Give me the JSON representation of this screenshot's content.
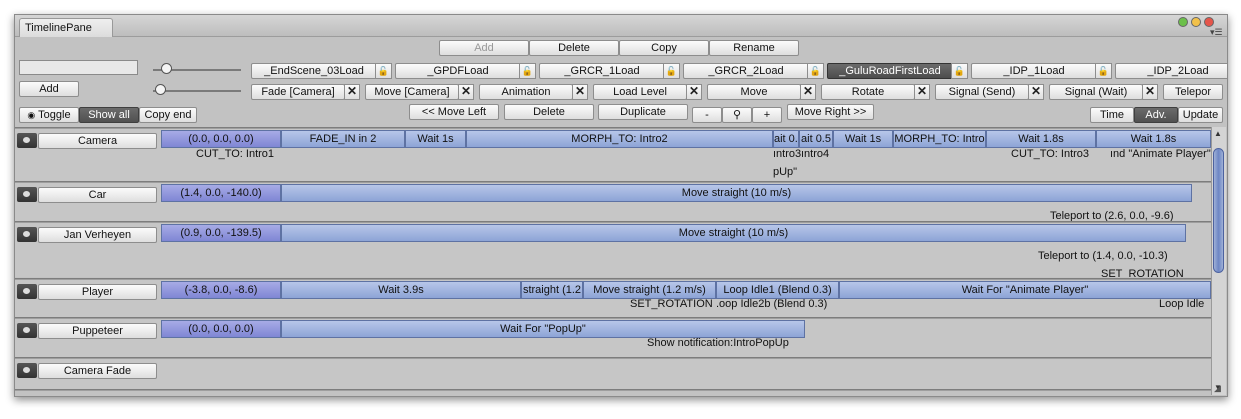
{
  "window": {
    "tab_title": "TimelinePane",
    "menu_glyph": "▾☰"
  },
  "toolbar": {
    "add_dim": "Add",
    "delete": "Delete",
    "copy": "Copy",
    "rename": "Rename",
    "add": "Add",
    "toggle": "Toggle",
    "show_all": "Show all",
    "copy_end": "Copy end",
    "move_left": "<< Move Left",
    "delete2": "Delete",
    "duplicate": "Duplicate",
    "zoom_out": "-",
    "zoom_in": "+",
    "move_right": "Move Right >>",
    "time": "Time",
    "adv": "Adv.",
    "update": "Update"
  },
  "levels": [
    {
      "label": "_EndScene_03Load"
    },
    {
      "label": "_GPDFLoad"
    },
    {
      "label": "_GRCR_1Load"
    },
    {
      "label": "_GRCR_2Load"
    },
    {
      "label": "_GuluRoadFirstLoad",
      "selected": true
    },
    {
      "label": "_IDP_1Load"
    },
    {
      "label": "_IDP_2Load"
    }
  ],
  "filters": [
    {
      "label": "Fade [Camera]"
    },
    {
      "label": "Move [Camera]"
    },
    {
      "label": "Animation"
    },
    {
      "label": "Load Level"
    },
    {
      "label": "Move"
    },
    {
      "label": "Rotate"
    },
    {
      "label": "Signal (Send)"
    },
    {
      "label": "Signal (Wait)"
    },
    {
      "label": "Telepor"
    }
  ],
  "close_glyph": "✕",
  "tracks": [
    {
      "name": "Camera",
      "segments": [
        "(0.0, 0.0, 0.0)",
        "FADE_IN in 2",
        "Wait 1s",
        "MORPH_TO: Intro2",
        "ait 0.5",
        "ait 0.5",
        "Wait 1s",
        "MORPH_TO: Intro",
        "Wait 1.8s",
        "Wait 1.8s"
      ],
      "notes": [
        "CUT_TO: Intro1",
        "ıntro3",
        "ıntro4",
        "pUp\"",
        "CUT_TO: Intro3",
        "ınd \"Animate Player\""
      ]
    },
    {
      "name": "Car",
      "segments": [
        "(1.4, 0.0, -140.0)",
        "Move straight (10 m/s)"
      ],
      "notes": [
        "Teleport to (2.6, 0.0, -9.6)"
      ]
    },
    {
      "name": "Jan Verheyen",
      "segments": [
        "(0.9, 0.0, -139.5)",
        "Move straight (10 m/s)"
      ],
      "notes": [
        "Teleport to (1.4, 0.0, -10.3)",
        "SET_ROTATION"
      ]
    },
    {
      "name": "Player",
      "segments": [
        "(-3.8, 0.0, -8.6)",
        "Wait 3.9s",
        "straight (1.2",
        "Move straight (1.2 m/s)",
        "Loop Idle1 (Blend 0.3)",
        "Wait For \"Animate Player\""
      ],
      "notes": [
        "SET_ROTATION",
        ".oop Idle2b (Blend 0.3)",
        "Loop Idle"
      ]
    },
    {
      "name": "Puppeteer",
      "segments": [
        "(0.0, 0.0, 0.0)",
        "Wait For \"PopUp\""
      ],
      "notes": [
        "Show notification:IntroPopUp"
      ]
    },
    {
      "name": "Camera Fade",
      "segments": [],
      "notes": []
    }
  ],
  "colors": {
    "segment": "#9fb2df",
    "start_segment": "#8f96dc",
    "selected_level": "#5a5a5a"
  }
}
